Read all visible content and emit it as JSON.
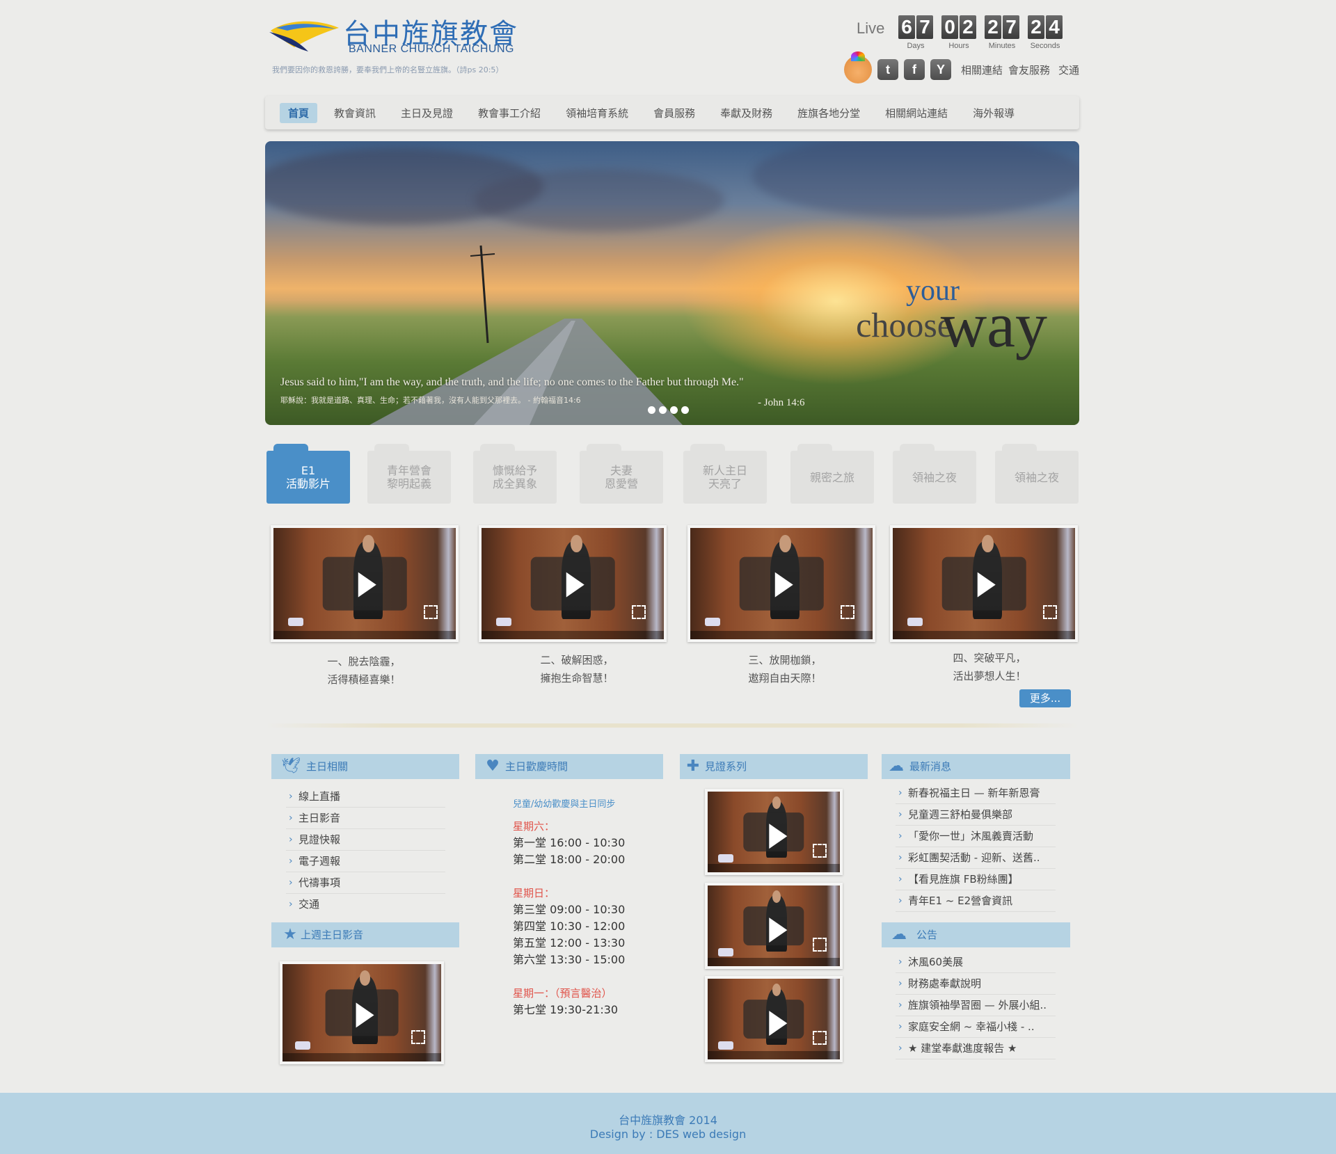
{
  "header": {
    "logo_title": "台中旌旗教會",
    "logo_subtitle": "BANNER CHURCH TAICHUNG",
    "logo_verse": "我們要因你的救恩誇勝，要奉我們上帝的名豎立旌旗。（詩ps 20:5）",
    "live_label": "Live",
    "countdown": [
      {
        "digits": [
          "6",
          "7"
        ],
        "unit": "Days"
      },
      {
        "digits": [
          "0",
          "2"
        ],
        "unit": "Hours"
      },
      {
        "digits": [
          "2",
          "7"
        ],
        "unit": "Minutes"
      },
      {
        "digits": [
          "2",
          "4"
        ],
        "unit": "Seconds"
      }
    ],
    "social": {
      "twitter": "t",
      "facebook": "f",
      "youtube": "Y"
    },
    "top_links": [
      "相關連結",
      "會友服務",
      "交通"
    ]
  },
  "nav": {
    "items": [
      "首頁",
      "教會資訊",
      "主日及見證",
      "教會事工介紹",
      "領袖培育系統",
      "會員服務",
      "奉獻及財務",
      "旌旗各地分堂",
      "相關網站連結",
      "海外報導"
    ]
  },
  "banner": {
    "word_your": "your",
    "word_choose": "choose",
    "word_way": "way",
    "quote_en": "Jesus said to him,\"I am the way, and the truth, and the life; no one comes to the Father but through Me.\"",
    "quote_zh": "耶穌說：我就是道路、真理、生命；若不藉著我，沒有人能到父那裡去。 - 約翰福音14:6",
    "quote_ref": "- John 14:6"
  },
  "categories": [
    {
      "line1": "E1",
      "line2": "活動影片"
    },
    {
      "line1": "青年營會",
      "line2": "黎明起義"
    },
    {
      "line1": "慷慨給予",
      "line2": "成全異象"
    },
    {
      "line1": "夫妻",
      "line2": "恩愛營"
    },
    {
      "line1": "新人主日",
      "line2": "天亮了"
    },
    {
      "line1": "親密之旅",
      "line2": ""
    },
    {
      "line1": "領袖之夜",
      "line2": ""
    },
    {
      "line1": "領袖之夜",
      "line2": ""
    }
  ],
  "videos": [
    {
      "line1": "一、脫去陰霾，",
      "line2": "活得積極喜樂！"
    },
    {
      "line1": "二、破解困惑，",
      "line2": "擁抱生命智慧！"
    },
    {
      "line1": "三、放開枷鎖，",
      "line2": "遨翔自由天際！"
    },
    {
      "line1": "四、突破平凡，",
      "line2": "活出夢想人生！"
    }
  ],
  "more_label": "更多...",
  "sunday": {
    "title": "主日相關",
    "items": [
      "線上直播",
      "主日影音",
      "見證快報",
      "電子週報",
      "代禱事項",
      "交通"
    ]
  },
  "last_week": {
    "title": "上週主日影音"
  },
  "schedule": {
    "title": "主日歡慶時間",
    "subtitle": "兒童/幼幼歡慶與主日同步",
    "saturday_label": "星期六：",
    "saturday": [
      "第一堂 16:00 - 10:30",
      "第二堂 18:00 - 20:00"
    ],
    "sunday_label": "星期日：",
    "sunday": [
      "第三堂 09:00 - 10:30",
      "第四堂 10:30 - 12:00",
      "第五堂 12:00 - 13:30",
      "第六堂 13:30 - 15:00"
    ],
    "monday_label": "星期一：（預言醫治）",
    "monday": [
      "第七堂 19:30-21:30"
    ]
  },
  "testimony": {
    "title": "見證系列"
  },
  "news": {
    "title": "最新消息",
    "items": [
      "新春祝福主日 — 新年新恩膏",
      "兒童週三舒柏曼俱樂部",
      "「愛你一世」沐風義賣活動",
      "彩虹團契活動 - 迎新、送舊..",
      "【看見旌旗 FB粉絲團】",
      "青年E1 ~ E2營會資訊"
    ]
  },
  "notice": {
    "title": "公告",
    "items": [
      "沐風60美展",
      "財務處奉獻說明",
      "旌旗領袖學習圈 — 外展小組..",
      "家庭安全網 ~ 幸福小棧 - ..",
      "★ 建堂奉獻進度報告 ★"
    ]
  },
  "footer": {
    "line1": "台中旌旗教會 2014",
    "line2": "Design by : DES web design"
  }
}
